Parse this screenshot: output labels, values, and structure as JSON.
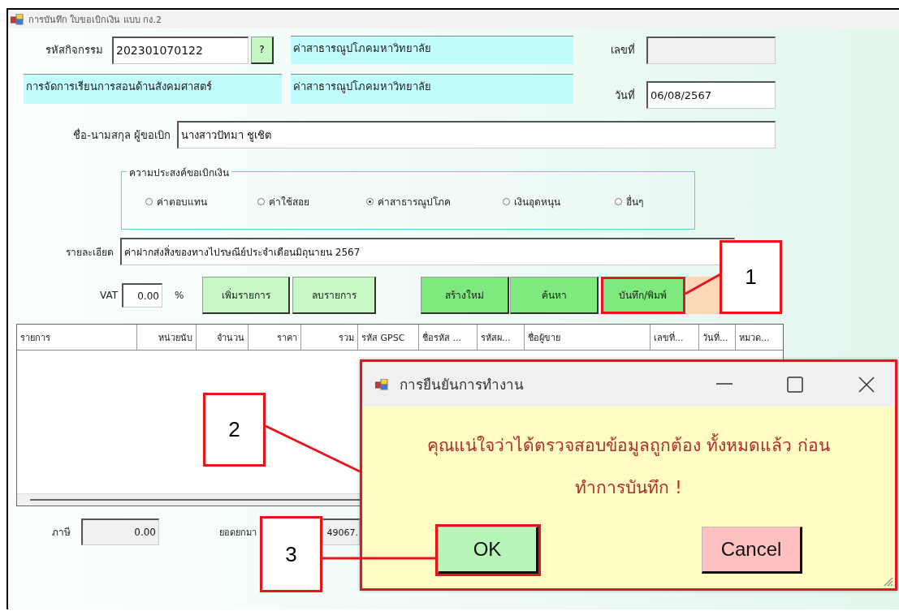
{
  "window": {
    "title": "การบันทึก ใบขอเบิกเงิน แบบ กง.2"
  },
  "form": {
    "activity_code_label": "รหัสกิจกรรม",
    "activity_code": "202301070122",
    "lookup_button": "?",
    "activity_name_1": "ค่าสาธารณูปโภคมหาวิทยาลัย",
    "number_label": "เลขที่",
    "activity_group": "การจัดการเรียนการสอนด้านสังคมศาสตร์",
    "activity_name_2": "ค่าสาธารณูปโภคมหาวิทยาลัย",
    "date_label": "วันที่",
    "date": "06/08/2567",
    "requester_label": "ชื่อ-นามสกุล ผู้ขอเบิก",
    "requester": "นางสาวปัทมา ชูเชิต"
  },
  "purpose": {
    "legend": "ความประสงค์ขอเบิกเงิน",
    "options": [
      {
        "label": "ค่าตอบแทน",
        "selected": false
      },
      {
        "label": "ค่าใช้สอย",
        "selected": false
      },
      {
        "label": "ค่าสาธารณูปโภค",
        "selected": true
      },
      {
        "label": "เงินอุดหนุน",
        "selected": false
      },
      {
        "label": "อื่นๆ",
        "selected": false
      }
    ]
  },
  "detail": {
    "label": "รายละเอียด",
    "value": "ค่าฝากส่งสิ่งของทางไปรษณีย์ประจำเดือนมิถุนายน 2567"
  },
  "vat": {
    "label": "VAT",
    "value": "0.00",
    "unit": "%"
  },
  "buttons": [
    {
      "label": "เพิ่มรายการ",
      "kind": "light",
      "highlighted": false
    },
    {
      "label": "ลบรายการ",
      "kind": "light",
      "highlighted": false
    },
    {
      "label": "สร้างใหม่",
      "kind": "strong",
      "highlighted": false
    },
    {
      "label": "ค้นหา",
      "kind": "strong",
      "highlighted": false
    },
    {
      "label": "บันทึก/พิมพ์",
      "kind": "strong",
      "highlighted": true
    },
    {
      "kind": "peach",
      "highlighted": false
    }
  ],
  "table": {
    "columns": [
      "รายการ",
      "หน่วยนับ",
      "จำนวน",
      "ราคา",
      "รวม",
      "รหัส GPSC",
      "ชื่อรหัส ...",
      "รหัสผ...",
      "ชื่อผู้ขาย",
      "เลขที่...",
      "วันที่...",
      "หมวด..."
    ]
  },
  "totals": {
    "tax_label": "ภาษี",
    "tax": "0.00",
    "carried_label": "ยอดยกมา",
    "carried": "49067."
  },
  "dialog": {
    "title": "การยืนยันการทำงาน",
    "message": "คุณแน่ใจว่าได้ตรวจสอบข้อมูลถูกต้อง ทั้งหมดแล้ว ก่อนทำการบันทึก !",
    "highlighted": true,
    "buttons": [
      {
        "label": "OK",
        "kind": "ok",
        "highlighted": true
      },
      {
        "label": "Cancel",
        "kind": "cancel",
        "highlighted": false
      }
    ]
  },
  "annotations": [
    {
      "label": "1"
    },
    {
      "label": "2"
    },
    {
      "label": "3"
    }
  ]
}
